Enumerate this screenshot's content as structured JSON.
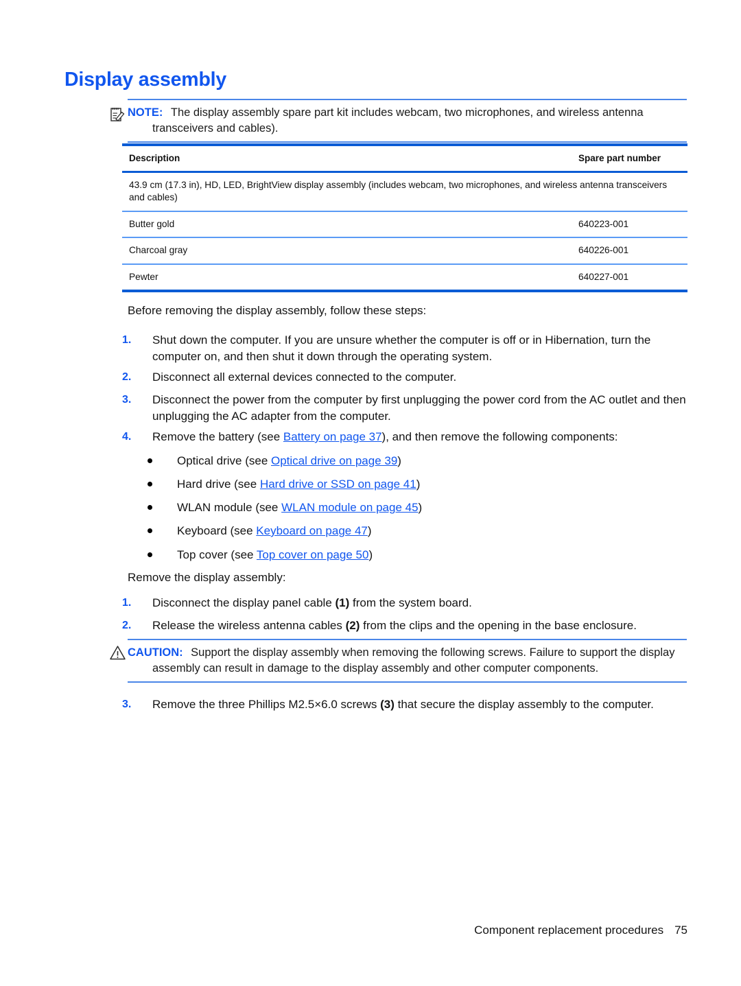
{
  "heading": "Display assembly",
  "note": {
    "icon": "note-pad-pencil-icon",
    "label": "NOTE:",
    "text": "The display assembly spare part kit includes webcam, two microphones, and wireless antenna transceivers and cables)."
  },
  "table": {
    "headers": {
      "description": "Description",
      "spare_part_number": "Spare part number"
    },
    "span_row": "43.9 cm (17.3 in), HD, LED, BrightView display assembly (includes webcam, two microphones, and wireless antenna transceivers and cables)",
    "rows": [
      {
        "description": "Butter gold",
        "part": "640223-001"
      },
      {
        "description": "Charcoal gray",
        "part": "640226-001"
      },
      {
        "description": "Pewter",
        "part": "640227-001"
      }
    ]
  },
  "before_intro": "Before removing the display assembly, follow these steps:",
  "before_steps": [
    {
      "num": "1.",
      "text": "Shut down the computer. If you are unsure whether the computer is off or in Hibernation, turn the computer on, and then shut it down through the operating system."
    },
    {
      "num": "2.",
      "text": "Disconnect all external devices connected to the computer."
    },
    {
      "num": "3.",
      "text": "Disconnect the power from the computer by first unplugging the power cord from the AC outlet and then unplugging the AC adapter from the computer."
    },
    {
      "num": "4.",
      "prefix": "Remove the battery (see ",
      "link": "Battery on page 37",
      "suffix": "), and then remove the following components:"
    }
  ],
  "components": [
    {
      "prefix": "Optical drive (see ",
      "link": "Optical drive on page 39",
      "suffix": ")"
    },
    {
      "prefix": "Hard drive (see ",
      "link": "Hard drive or SSD on page 41",
      "suffix": ")"
    },
    {
      "prefix": "WLAN module (see ",
      "link": "WLAN module on page 45",
      "suffix": ")"
    },
    {
      "prefix": "Keyboard (see ",
      "link": "Keyboard on page 47",
      "suffix": ")"
    },
    {
      "prefix": "Top cover (see ",
      "link": "Top cover on page 50",
      "suffix": ")"
    }
  ],
  "remove_intro": "Remove the display assembly:",
  "remove_steps": [
    {
      "num": "1.",
      "prefix": "Disconnect the display panel cable ",
      "callout": "(1)",
      "suffix": " from the system board."
    },
    {
      "num": "2.",
      "prefix": "Release the wireless antenna cables ",
      "callout": "(2)",
      "suffix": " from the clips and the opening in the base enclosure."
    },
    {
      "num": "3.",
      "prefix": "Remove the three Phillips M2.5×6.0 screws ",
      "callout": "(3)",
      "suffix": " that secure the display assembly to the computer."
    }
  ],
  "caution": {
    "icon": "warning-triangle-icon",
    "label": "CAUTION:",
    "text": "Support the display assembly when removing the following screws. Failure to support the display assembly can result in damage to the display assembly and other computer components."
  },
  "footer": {
    "chapter": "Component replacement procedures",
    "page_number": "75"
  },
  "colors": {
    "heading_blue": "#1156ee",
    "link_blue": "#1156ee",
    "table_border_strong": "#0b5cd5",
    "table_border_light": "#5b9bf5",
    "admonition_rule": "#4a86e8"
  }
}
